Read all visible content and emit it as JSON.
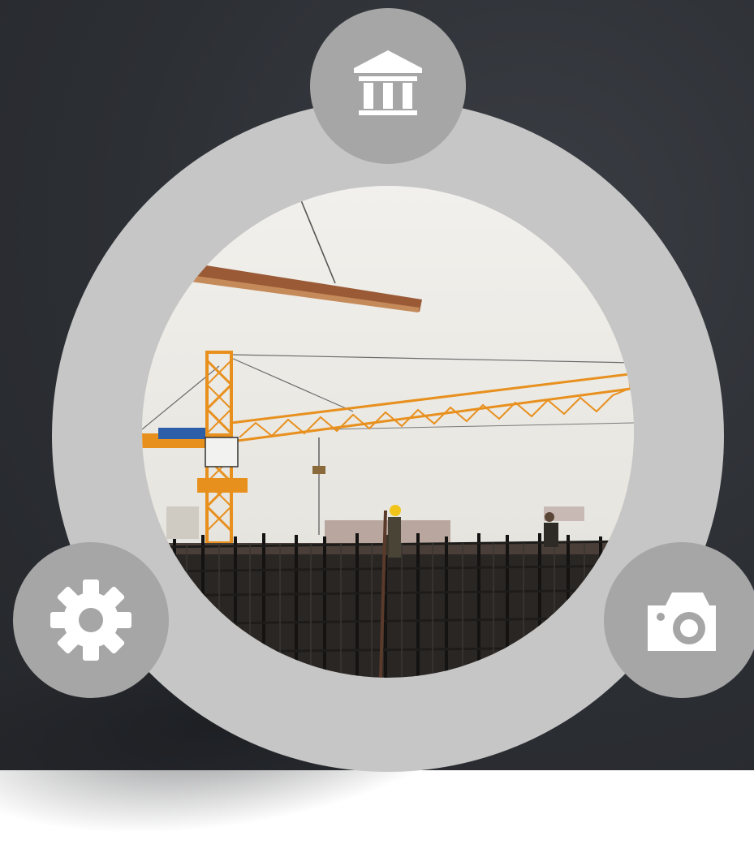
{
  "background": {
    "color": "#2c2f34"
  },
  "ring": {
    "color": "#c6c6c6"
  },
  "nodes": [
    {
      "icon": "bank-icon",
      "color": "#a6a6a6"
    },
    {
      "icon": "gear-icon",
      "color": "#a6a6a6"
    },
    {
      "icon": "camera-icon",
      "color": "#a6a6a6"
    }
  ],
  "photo": {
    "subject": "construction-site-with-tower-crane",
    "crane_color": "#e8901e",
    "sky_color": "#ecebe7"
  },
  "icon_color": "#ffffff"
}
